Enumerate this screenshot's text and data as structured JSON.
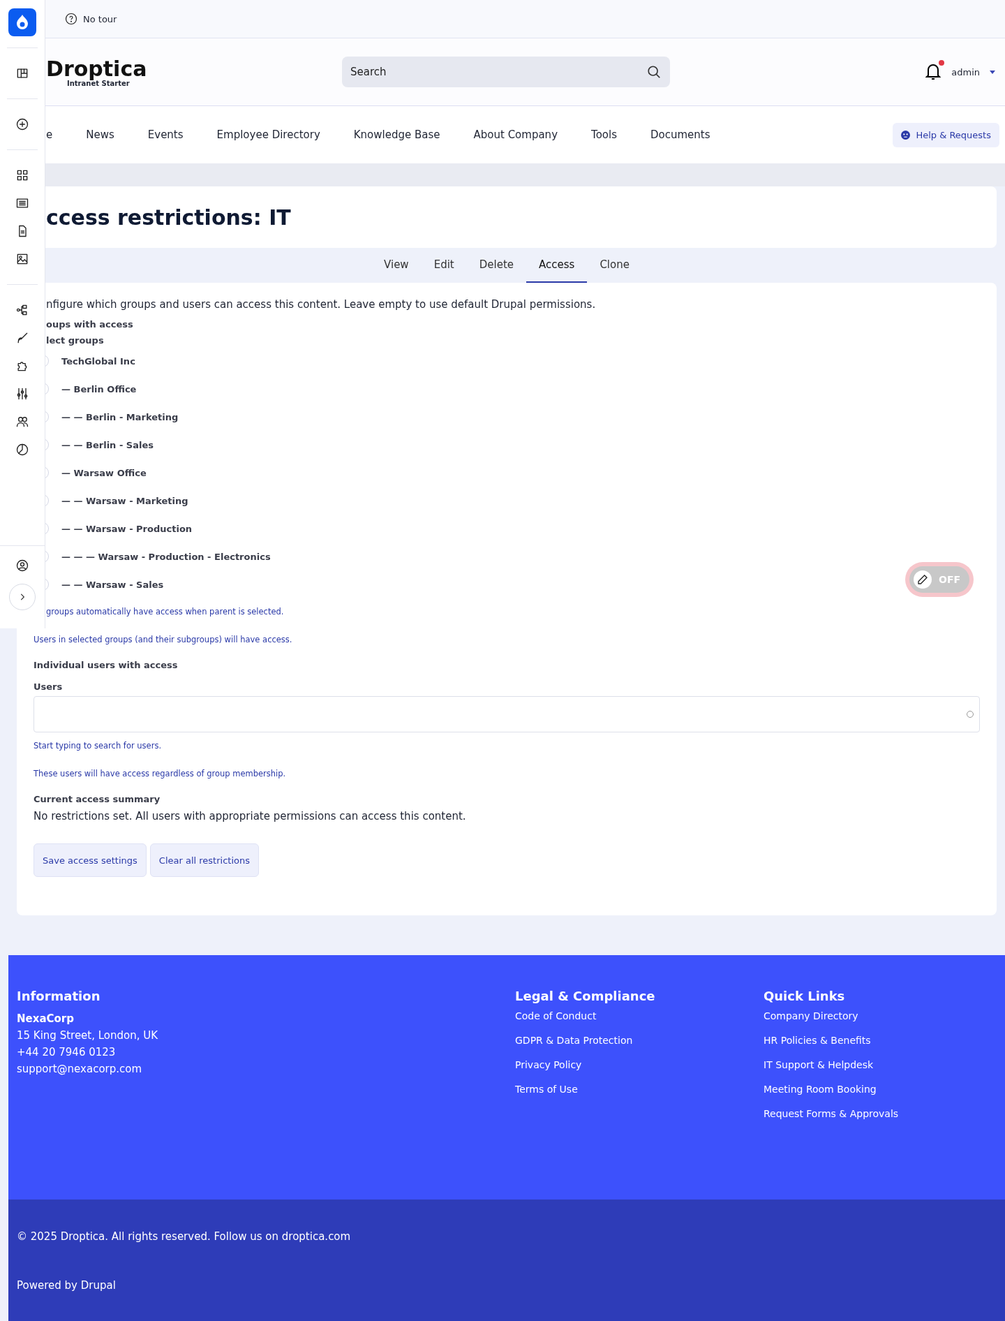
{
  "topbar": {
    "tour": "No tour"
  },
  "header": {
    "logo": "Droptica",
    "logo_subtitle": "Intranet Starter",
    "search": {
      "placeholder": "Search"
    },
    "notifications": {
      "unread": true
    },
    "user": "admin"
  },
  "nav": {
    "items": [
      "e",
      "News",
      "Events",
      "Employee Directory",
      "Knowledge Base",
      "About Company",
      "Tools",
      "Documents"
    ],
    "help_button": "Help & Requests"
  },
  "page": {
    "title": "ccess restrictions: IT",
    "tabs": [
      {
        "label": "View",
        "selected": false
      },
      {
        "label": "Edit",
        "selected": false
      },
      {
        "label": "Delete",
        "selected": false
      },
      {
        "label": "Access",
        "selected": true
      },
      {
        "label": "Clone",
        "selected": false
      }
    ],
    "description": "nfigure which groups and users can access this content. Leave empty to use default Drupal permissions.",
    "groups_heading": "oups with access",
    "groups_label": "lect groups",
    "groups": [
      {
        "label": "TechGlobal Inc",
        "checked": false
      },
      {
        "label": "— Berlin Office",
        "checked": false
      },
      {
        "label": "— — Berlin - Marketing",
        "checked": false
      },
      {
        "label": "— — Berlin - Sales",
        "checked": false
      },
      {
        "label": "— Warsaw Office",
        "checked": false
      },
      {
        "label": "— — Warsaw - Marketing",
        "checked": false
      },
      {
        "label": "— — Warsaw - Production",
        "checked": false
      },
      {
        "label": "— — — Warsaw - Production - Electronics",
        "checked": false
      },
      {
        "label": "— — Warsaw - Sales",
        "checked": false
      }
    ],
    "groups_help": [
      "groups automatically have access when parent is selected.",
      "Users in selected groups (and their subgroups) will have access."
    ],
    "users_heading": "Individual users with access",
    "users_label": "Users",
    "users_help": [
      "Start typing to search for users.",
      "These users will have access regardless of group membership."
    ],
    "summary_heading": "Current access summary",
    "summary": "No restrictions set. All users with appropriate permissions can access this content.",
    "buttons": [
      "Save access settings",
      "Clear all restrictions"
    ]
  },
  "edit_toggle": {
    "label": "OFF",
    "on": false
  },
  "footer": {
    "columns": [
      {
        "title": "Information",
        "lines": [
          {
            "text": "NexaCorp",
            "kind": "strong"
          },
          {
            "text": "15 King Street, London, UK",
            "kind": "text"
          },
          {
            "text": "+44 20 7946 0123",
            "kind": "text"
          },
          {
            "text": "support@nexacorp.com",
            "kind": "text"
          }
        ]
      },
      {
        "title": "Legal & Compliance",
        "lines": [
          {
            "text": "Code of Conduct",
            "kind": "link"
          },
          {
            "text": "GDPR & Data Protection",
            "kind": "link"
          },
          {
            "text": "Privacy Policy",
            "kind": "link"
          },
          {
            "text": "Terms of Use",
            "kind": "link"
          }
        ]
      },
      {
        "title": "Quick Links",
        "lines": [
          {
            "text": "Company Directory",
            "kind": "link"
          },
          {
            "text": "HR Policies & Benefits",
            "kind": "link"
          },
          {
            "text": "IT Support & Helpdesk",
            "kind": "link"
          },
          {
            "text": "Meeting Room Booking",
            "kind": "link"
          },
          {
            "text": "Request Forms & Approvals",
            "kind": "link"
          }
        ]
      }
    ],
    "copyright": "© 2025 Droptica. All rights reserved. Follow us on droptica.com",
    "powered": "Powered by Drupal"
  }
}
